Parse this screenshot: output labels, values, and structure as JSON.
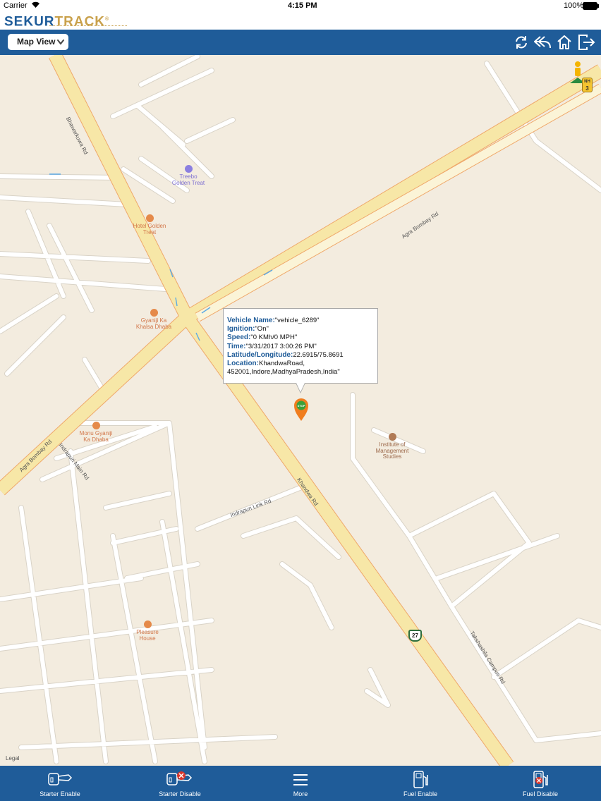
{
  "status_bar": {
    "carrier": "Carrier",
    "time": "4:15 PM",
    "battery": "100%"
  },
  "brand": {
    "part1": "SEKUR",
    "part2": "TRACK",
    "registered": "®"
  },
  "header": {
    "view_select": "Map View",
    "icons": [
      "refresh-icon",
      "back-icon",
      "home-icon",
      "logout-icon"
    ]
  },
  "map": {
    "roads": {
      "bhawarkuwa": "Bhawarkuwa Rd",
      "agra_bombay_ne": "Agra Bombay Rd",
      "agra_bombay_sw": "Agra Bombay Rd",
      "khandwa": "Khandwa Rd",
      "indrapuri_main": "Indrapuri Main Rd",
      "indrapuri_link": "Indrapuri Link Rd",
      "takshashila": "Takshashila Campus Rd"
    },
    "pois": {
      "treebo_1": "Treebo",
      "treebo_2": "Golden Treat",
      "hotel_1": "Hotel Golden",
      "hotel_2": "Treat",
      "gyaniji_1": "Gyaniji Ka",
      "gyaniji_2": "Khalsa Dhaba",
      "monu_1": "Monu Gyaniji",
      "monu_2": "Ka Dhaba",
      "inst_1": "Institute of",
      "inst_2": "Management",
      "inst_3": "Studies",
      "pleasure_1": "Pleasure",
      "pleasure_2": "House"
    },
    "shield_nh": "NH",
    "shield_nh_num": "3",
    "shield_27": "27",
    "legal": "Legal",
    "marker_text": "STOP"
  },
  "info": {
    "vehicle_label": "Vehicle Name:",
    "vehicle_value": "\"vehicle_6289\"",
    "ignition_label": "Ignition:",
    "ignition_value": "\"On\"",
    "speed_label": "Speed:",
    "speed_value": "\"0 KMh/0 MPH\"",
    "time_label": "Time:",
    "time_value": "\"3/31/2017 3:00:26 PM\"",
    "latlng_label": "Latitude/Longitude:",
    "latlng_value": "22.6915/75.8691",
    "location_label": "Location:",
    "location_value_1": "KhandwaRoad,",
    "location_value_2": "452001,Indore,MadhyaPradesh,India\""
  },
  "tabs": [
    {
      "label": "Starter Enable"
    },
    {
      "label": "Starter Disable"
    },
    {
      "label": "More"
    },
    {
      "label": "Fuel Enable"
    },
    {
      "label": "Fuel Disable"
    }
  ],
  "colors": {
    "brand_blue": "#1f5c99",
    "brand_gold": "#c9a14c",
    "map_bg": "#f3ecdf",
    "major_road": "#f7e7a7",
    "minor_road": "#ffffff"
  }
}
